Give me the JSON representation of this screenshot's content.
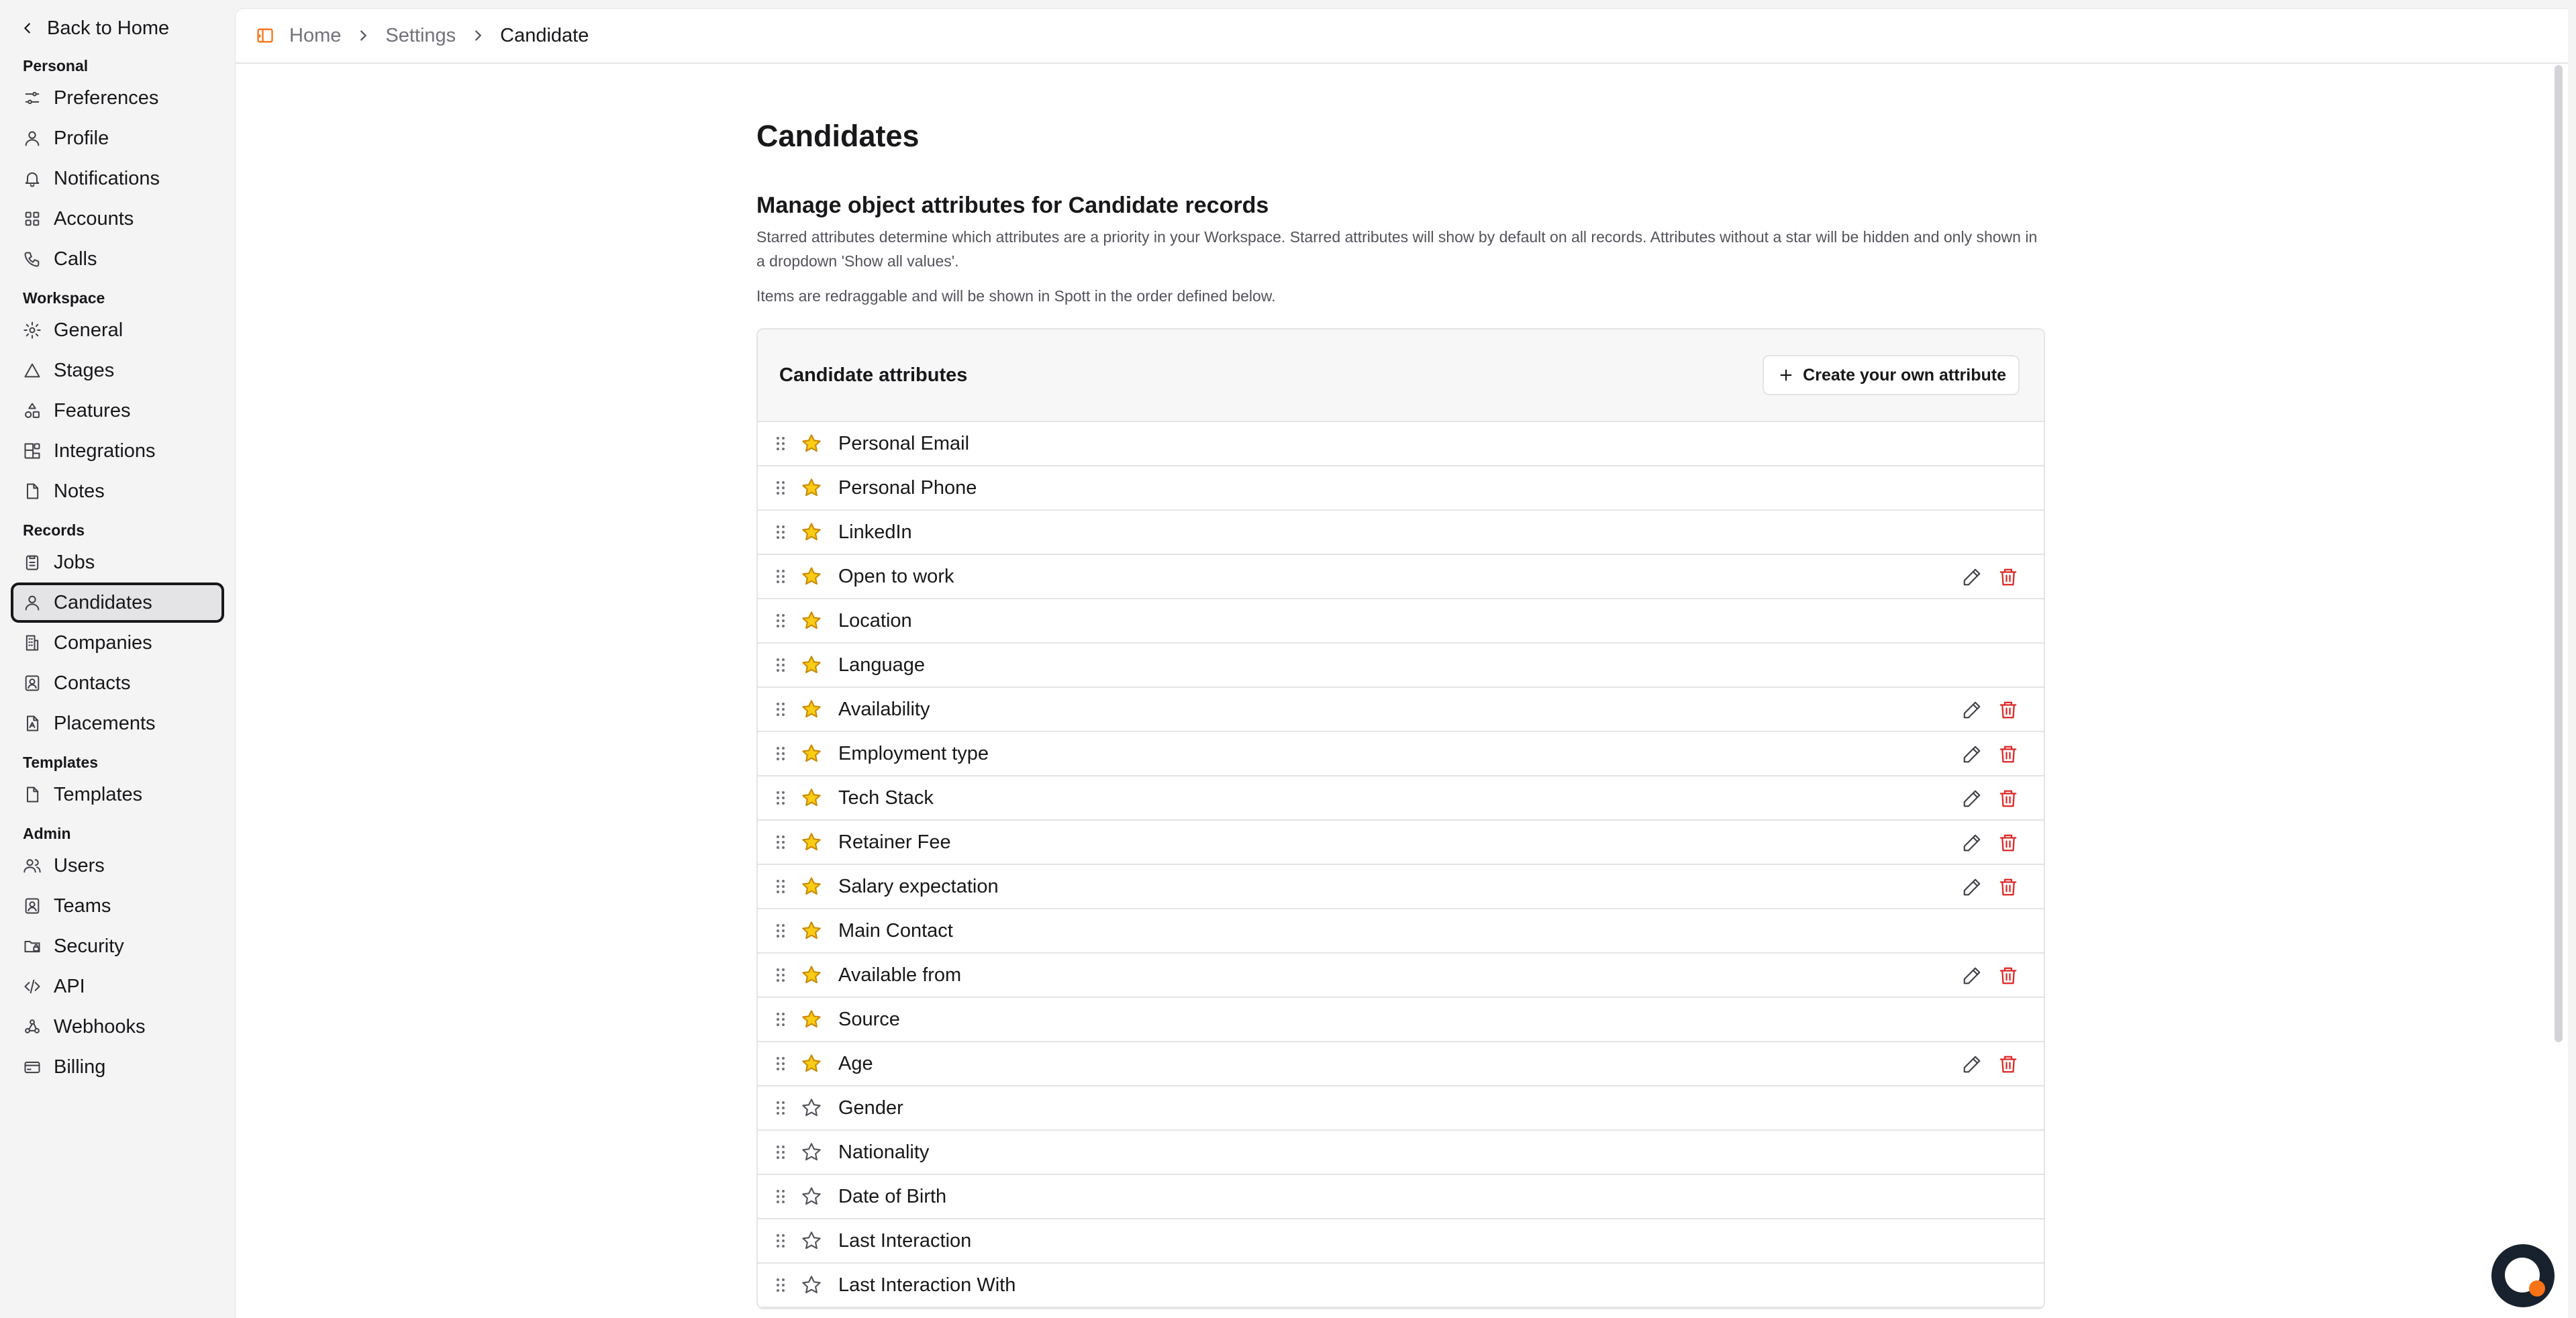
{
  "sidebar": {
    "back_label": "Back to Home",
    "sections": [
      {
        "label": "Personal",
        "items": [
          {
            "label": "Preferences",
            "icon": "sliders-icon"
          },
          {
            "label": "Profile",
            "icon": "user-icon"
          },
          {
            "label": "Notifications",
            "icon": "bell-icon"
          },
          {
            "label": "Accounts",
            "icon": "grid-icon"
          },
          {
            "label": "Calls",
            "icon": "phone-icon"
          }
        ]
      },
      {
        "label": "Workspace",
        "items": [
          {
            "label": "General",
            "icon": "gear-icon"
          },
          {
            "label": "Stages",
            "icon": "triangle-icon"
          },
          {
            "label": "Features",
            "icon": "shapes-icon"
          },
          {
            "label": "Integrations",
            "icon": "blocks-icon"
          },
          {
            "label": "Notes",
            "icon": "file-icon"
          }
        ]
      },
      {
        "label": "Records",
        "items": [
          {
            "label": "Jobs",
            "icon": "clipboard-icon"
          },
          {
            "label": "Candidates",
            "icon": "user-icon",
            "active": true
          },
          {
            "label": "Companies",
            "icon": "building-icon"
          },
          {
            "label": "Contacts",
            "icon": "contact-icon"
          },
          {
            "label": "Placements",
            "icon": "file-person-icon"
          }
        ]
      },
      {
        "label": "Templates",
        "items": [
          {
            "label": "Templates",
            "icon": "file-icon"
          }
        ]
      },
      {
        "label": "Admin",
        "items": [
          {
            "label": "Users",
            "icon": "users-icon"
          },
          {
            "label": "Teams",
            "icon": "contact-icon"
          },
          {
            "label": "Security",
            "icon": "folder-lock-icon"
          },
          {
            "label": "API",
            "icon": "code-icon"
          },
          {
            "label": "Webhooks",
            "icon": "webhook-icon"
          },
          {
            "label": "Billing",
            "icon": "card-icon"
          }
        ]
      }
    ]
  },
  "breadcrumb": {
    "home": "Home",
    "settings": "Settings",
    "current": "Candidate"
  },
  "main": {
    "title": "Candidates",
    "section_title": "Manage object attributes for Candidate records",
    "description": "Starred attributes determine which attributes are a priority in your Workspace. Starred attributes will show by default on all records. Attributes without a star will be hidden and only shown in a dropdown 'Show all values'.",
    "description2": "Items are redraggable and will be shown in Spott in the order defined below.",
    "card_title": "Candidate attributes",
    "create_label": "Create your own attribute",
    "attributes": [
      {
        "label": "Personal Email",
        "starred": true,
        "editable": false
      },
      {
        "label": "Personal Phone",
        "starred": true,
        "editable": false
      },
      {
        "label": "LinkedIn",
        "starred": true,
        "editable": false
      },
      {
        "label": "Open to work",
        "starred": true,
        "editable": true
      },
      {
        "label": "Location",
        "starred": true,
        "editable": false
      },
      {
        "label": "Language",
        "starred": true,
        "editable": false
      },
      {
        "label": "Availability",
        "starred": true,
        "editable": true
      },
      {
        "label": "Employment type",
        "starred": true,
        "editable": true
      },
      {
        "label": "Tech Stack",
        "starred": true,
        "editable": true
      },
      {
        "label": "Retainer Fee",
        "starred": true,
        "editable": true
      },
      {
        "label": "Salary expectation",
        "starred": true,
        "editable": true
      },
      {
        "label": "Main Contact",
        "starred": true,
        "editable": false
      },
      {
        "label": "Available from",
        "starred": true,
        "editable": true
      },
      {
        "label": "Source",
        "starred": true,
        "editable": false
      },
      {
        "label": "Age",
        "starred": true,
        "editable": true
      },
      {
        "label": "Gender",
        "starred": false,
        "editable": false
      },
      {
        "label": "Nationality",
        "starred": false,
        "editable": false
      },
      {
        "label": "Date of Birth",
        "starred": false,
        "editable": false
      },
      {
        "label": "Last Interaction",
        "starred": false,
        "editable": false
      },
      {
        "label": "Last Interaction With",
        "starred": false,
        "editable": false
      }
    ]
  },
  "colors": {
    "star_fill": "#facc15",
    "star_stroke": "#ca8a04",
    "delete": "#dc2626",
    "breadcrumb_icon": "#f97316",
    "help_dot": "#f97316"
  }
}
